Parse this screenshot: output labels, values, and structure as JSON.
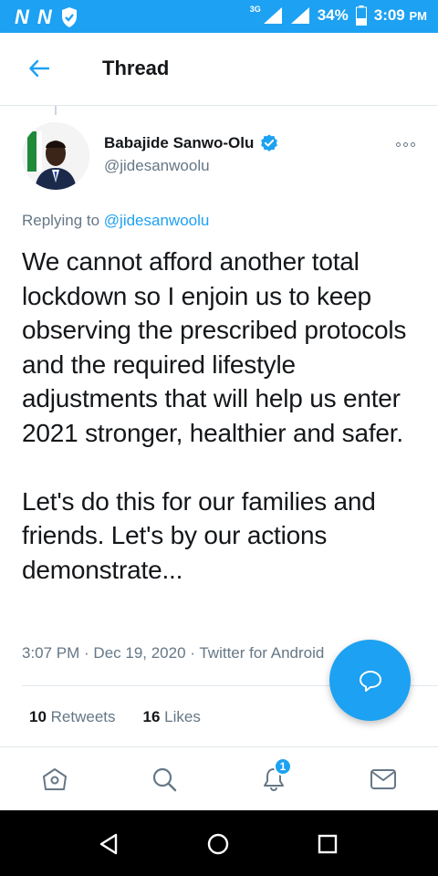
{
  "status_bar": {
    "notif_icons": [
      "N",
      "N"
    ],
    "network": "3G",
    "battery": "34%",
    "time": "3:09",
    "time_suffix": "PM"
  },
  "header": {
    "title": "Thread"
  },
  "tweet": {
    "author_name": "Babajide Sanwo-Olu",
    "author_handle": "@jidesanwoolu",
    "replying_prefix": "Replying to ",
    "replying_mention": "@jidesanwoolu",
    "text": "We cannot afford another total lockdown so I enjoin us to keep observing the prescribed protocols and the required lifestyle adjustments that will help us enter 2021 stronger, healthier and safer.\n\nLet's do this for our families and friends. Let's by our actions demonstrate...",
    "meta": "3:07 PM · Dec 19, 2020 · Twitter for Android",
    "retweets_count": "10",
    "retweets_label": " Retweets",
    "likes_count": "16",
    "likes_label": " Likes"
  },
  "tabbar": {
    "notifications_badge": "1"
  },
  "colors": {
    "accent": "#1da1f2",
    "text": "#14171a",
    "secondary": "#657786"
  }
}
